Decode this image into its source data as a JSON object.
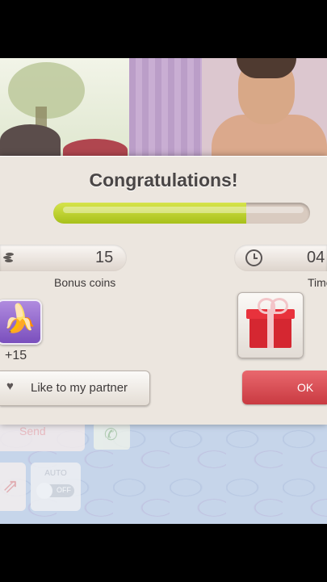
{
  "dialog": {
    "title": "Congratulations!",
    "progress_fraction": 0.75,
    "bonus_coins": {
      "value": "15",
      "caption": "Bonus coins",
      "icon": "coins-icon"
    },
    "time": {
      "value": "04",
      "caption": "Time",
      "icon": "clock-icon"
    },
    "reward": {
      "item_icon": "banana-icon",
      "amount": "+15"
    },
    "gift": {
      "icon": "gift-icon"
    },
    "like_button": {
      "label": "Like to my partner",
      "icon": "heart-icon"
    },
    "ok_button": {
      "label": "OK"
    }
  },
  "background_ui": {
    "send_label": "Send",
    "auto_label": "AUTO",
    "auto_toggle_text": "OFF"
  },
  "colors": {
    "progress_fill": "#a7c01a",
    "ok_button": "#c93a41",
    "dialog_bg": "#ece6df"
  }
}
